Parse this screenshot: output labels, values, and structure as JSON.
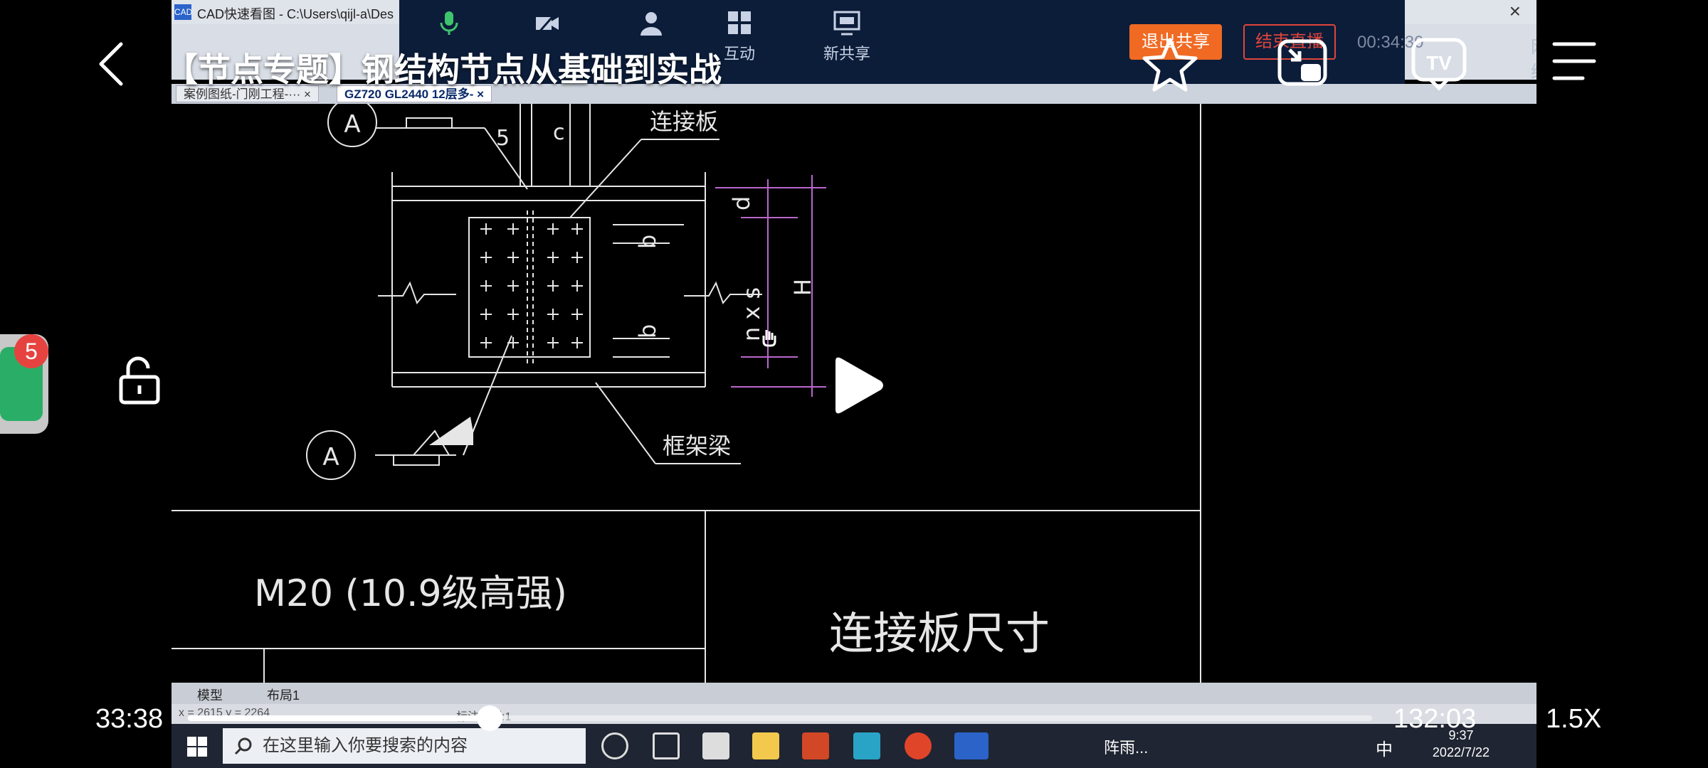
{
  "player": {
    "title": "【节点专题】钢结构节点从基础到实战",
    "time_current": "33:38",
    "time_total": "132:03",
    "speed": "1.5X",
    "progress_fraction": 0.2547,
    "wechat_badge_count": "5"
  },
  "recording": {
    "window_title": "CAD快速看图 - C:\\Users\\qijl-a\\Des",
    "app_icon_label": "CAD",
    "meeting": {
      "interact_label": "互动",
      "new_share_label": "新共享",
      "exit_share_label": "退出共享",
      "end_live_label": "结束直播",
      "elapsed": "00:34:30",
      "network_status": "网络良好"
    },
    "doc_tabs": [
      "案例图纸-门刚工程-···",
      "GZ720 GL2440 12层多-"
    ],
    "drawing": {
      "section_mark": "A",
      "label_plate": "连接板",
      "label_beam": "框架梁",
      "dim_d": "d",
      "dim_b": "b",
      "dim_nxs": "n x s",
      "dim_H": "H",
      "dim_5": "5",
      "dim_c": "c",
      "bolt_spec": "M20  (10.9级高强)",
      "table_header": "连接板尺寸"
    },
    "layout_tabs": [
      "模型",
      "布局1"
    ],
    "status_text": "x = 2615  y = 2264",
    "status_scale": "标注比例:1",
    "taskbar": {
      "search_placeholder": "在这里输入你要搜索的内容",
      "weather": "阵雨...",
      "ime": "中",
      "time": "9:37",
      "date": "2022/7/22"
    }
  }
}
